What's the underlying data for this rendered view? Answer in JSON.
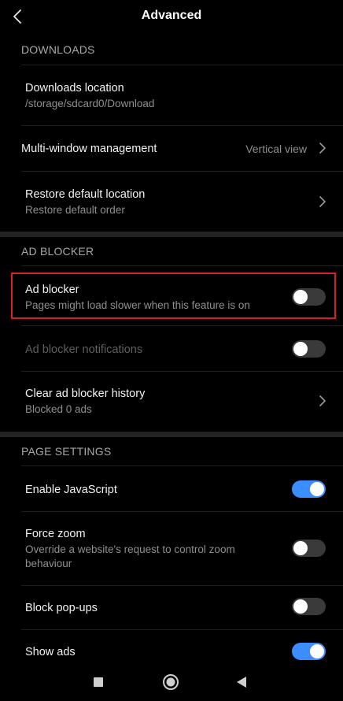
{
  "header": {
    "title": "Advanced",
    "back_icon": "chevron-left-icon"
  },
  "sections": {
    "downloads": {
      "header": "DOWNLOADS",
      "downloads_location": {
        "title": "Downloads location",
        "subtitle": "/storage/sdcard0/Download"
      },
      "multi_window": {
        "title": "Multi-window management",
        "value": "Vertical view"
      },
      "restore_default": {
        "title": "Restore default location",
        "subtitle": "Restore default order"
      }
    },
    "ad_blocker": {
      "header": "AD BLOCKER",
      "ad_blocker": {
        "title": "Ad blocker",
        "subtitle": "Pages might load slower when this feature is on",
        "enabled": false
      },
      "notifications": {
        "title": "Ad blocker notifications",
        "enabled": false,
        "disabled_row": true
      },
      "clear_history": {
        "title": "Clear ad blocker history",
        "subtitle": "Blocked 0 ads"
      }
    },
    "page_settings": {
      "header": "PAGE SETTINGS",
      "enable_javascript": {
        "title": "Enable JavaScript",
        "enabled": true
      },
      "force_zoom": {
        "title": "Force zoom",
        "subtitle_line1": "Override a website's request to control zoom",
        "subtitle_line2": "behaviour",
        "enabled": false
      },
      "block_popups": {
        "title": "Block pop-ups",
        "enabled": false
      },
      "show_ads": {
        "title": "Show ads",
        "enabled": true
      }
    }
  },
  "navbar": {
    "recents_icon": "square-icon",
    "home_icon": "circle-icon",
    "back_icon": "triangle-back-icon"
  },
  "colors": {
    "background": "#000000",
    "toggle_on": "#3c8dff",
    "toggle_off": "#3a3a3a",
    "highlight_border": "#d61f26"
  }
}
